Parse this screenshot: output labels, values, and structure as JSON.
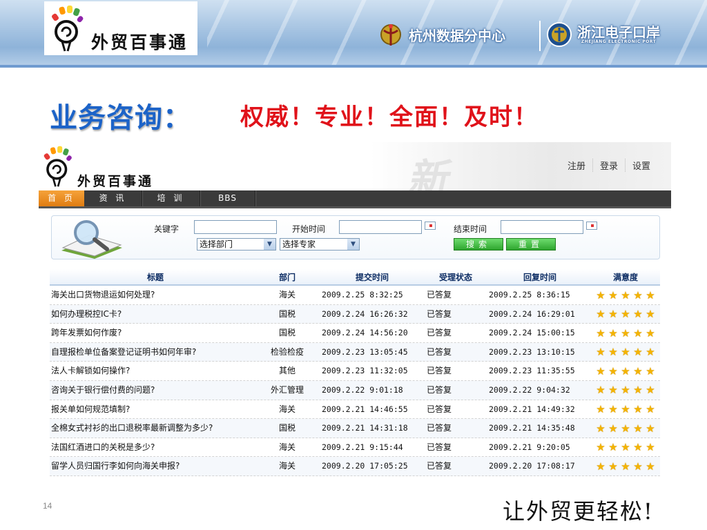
{
  "banner": {
    "logo_text": "外贸百事通",
    "brand1": "杭州数据分中心",
    "brand2_cn": "浙江电子口岸",
    "brand2_en": "ZHEJIANG ELECTRONIC PORT"
  },
  "heading": {
    "title": "业务咨询：",
    "tagline": "权威！专业！全面！及时！"
  },
  "site": {
    "logo_text": "外贸百事通",
    "toplinks": [
      "注册",
      "登录",
      "设置"
    ],
    "nav": [
      "首 页",
      "资 讯",
      "培 训",
      "BBS"
    ],
    "nav_active_index": 0,
    "search": {
      "keyword_label": "关键字",
      "start_label": "开始时间",
      "end_label": "结束时间",
      "dept_select": "选择部门",
      "expert_select": "选择专家",
      "search_button": "搜索",
      "reset_button": "重置"
    },
    "table": {
      "headers": [
        "标题",
        "部门",
        "提交时间",
        "受理状态",
        "回复时间",
        "满意度"
      ],
      "rows": [
        {
          "title": "海关出口货物退运如何处理?",
          "dept": "海关",
          "submit": "2009.2.25 8:32:25",
          "status": "已答复",
          "reply": "2009.2.25 8:36:15",
          "rating": 5
        },
        {
          "title": "如何办理税控IC卡?",
          "dept": "国税",
          "submit": "2009.2.24 16:26:32",
          "status": "已答复",
          "reply": "2009.2.24 16:29:01",
          "rating": 5
        },
        {
          "title": "跨年发票如何作废?",
          "dept": "国税",
          "submit": "2009.2.24 14:56:20",
          "status": "已答复",
          "reply": "2009.2.24 15:00:15",
          "rating": 5
        },
        {
          "title": "自理报检单位备案登记证明书如何年审?",
          "dept": "检验检疫",
          "submit": "2009.2.23 13:05:45",
          "status": "已答复",
          "reply": "2009.2.23 13:10:15",
          "rating": 5
        },
        {
          "title": "法人卡解锁如何操作?",
          "dept": "其他",
          "submit": "2009.2.23 11:32:05",
          "status": "已答复",
          "reply": "2009.2.23 11:35:55",
          "rating": 5
        },
        {
          "title": "咨询关于银行偿付费的问题?",
          "dept": "外汇管理",
          "submit": "2009.2.22 9:01:18",
          "status": "已答复",
          "reply": "2009.2.22 9:04:32",
          "rating": 5
        },
        {
          "title": "报关单如何规范填制?",
          "dept": "海关",
          "submit": "2009.2.21 14:46:55",
          "status": "已答复",
          "reply": "2009.2.21 14:49:32",
          "rating": 5
        },
        {
          "title": "全棉女式衬衫的出口退税率最新调整为多少?",
          "dept": "国税",
          "submit": "2009.2.21 14:31:18",
          "status": "已答复",
          "reply": "2009.2.21 14:35:48",
          "rating": 5
        },
        {
          "title": "法国红酒进口的关税是多少?",
          "dept": "海关",
          "submit": "2009.2.21 9:15:44",
          "status": "已答复",
          "reply": "2009.2.21 9:20:05",
          "rating": 5
        },
        {
          "title": "留学人员归国行李如何向海关申报?",
          "dept": "海关",
          "submit": "2009.2.20 17:05:25",
          "status": "已答复",
          "reply": "2009.2.20 17:08:17",
          "rating": 5
        }
      ]
    }
  },
  "footer": {
    "page_number": "14",
    "slogan": "让外贸更轻松!"
  }
}
